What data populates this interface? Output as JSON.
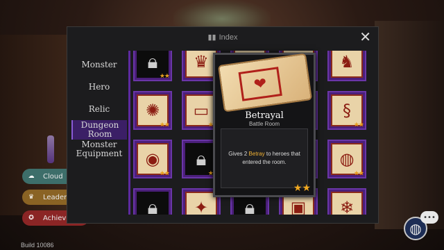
{
  "header": {
    "title": "Index",
    "close_icon": "close-icon"
  },
  "categories": [
    {
      "label": "Monster",
      "active": false
    },
    {
      "label": "Hero",
      "active": false
    },
    {
      "label": "Relic",
      "active": false
    },
    {
      "label": "Dungeon Room",
      "active": true
    },
    {
      "label": "Monster Equipment",
      "active": false
    }
  ],
  "grid": {
    "rows": [
      [
        {
          "icon": "lock-icon",
          "locked": true,
          "stars": 2
        },
        {
          "icon": "crown-icon",
          "locked": false,
          "stars": 0
        },
        {
          "icon": "scroll-icon",
          "locked": false,
          "stars": 0
        },
        {
          "icon": "tile-icon",
          "locked": false,
          "stars": 0
        },
        {
          "icon": "dragon-icon",
          "locked": false,
          "stars": 0
        }
      ],
      [
        {
          "icon": "egg-gear-icon",
          "locked": false,
          "stars": 2
        },
        {
          "icon": "chest-icon",
          "locked": false,
          "stars": 2
        },
        {
          "icon": "scroll-icon",
          "locked": false,
          "stars": 0
        },
        {
          "icon": "tile-icon",
          "locked": false,
          "stars": 2
        },
        {
          "icon": "snake-icon",
          "locked": false,
          "stars": 2
        }
      ],
      [
        {
          "icon": "eye-icon",
          "locked": false,
          "stars": 2
        },
        {
          "icon": "lock-icon",
          "locked": true,
          "stars": 2
        },
        {
          "icon": "scroll-icon",
          "locked": false,
          "stars": 0
        },
        {
          "icon": "tile-icon",
          "locked": false,
          "stars": 2
        },
        {
          "icon": "ninja-icon",
          "locked": false,
          "stars": 2
        }
      ],
      [
        {
          "icon": "lock-icon",
          "locked": true,
          "stars": 0
        },
        {
          "icon": "blood-icon",
          "locked": false,
          "stars": 0
        },
        {
          "icon": "lock-icon",
          "locked": true,
          "stars": 0
        },
        {
          "icon": "tile-icon",
          "locked": false,
          "stars": 0
        },
        {
          "icon": "snowflake-icon",
          "locked": false,
          "stars": 0
        }
      ]
    ]
  },
  "popup": {
    "title": "Betrayal",
    "subtitle": "Battle Room",
    "desc_prefix": "Gives 2 ",
    "desc_highlight": "Betray",
    "desc_suffix": " to heroes that entered the room.",
    "stars": 2
  },
  "side_buttons": [
    {
      "label": "Cloud",
      "icon": "cloud-icon"
    },
    {
      "label": "Leaderb",
      "icon": "crown-icon"
    },
    {
      "label": "Achieve",
      "icon": "ribbon-icon"
    }
  ],
  "build": "Build 10086",
  "colors": {
    "accent": "#5d2aa0",
    "star": "#f0a820",
    "highlight": "#f2b233"
  }
}
